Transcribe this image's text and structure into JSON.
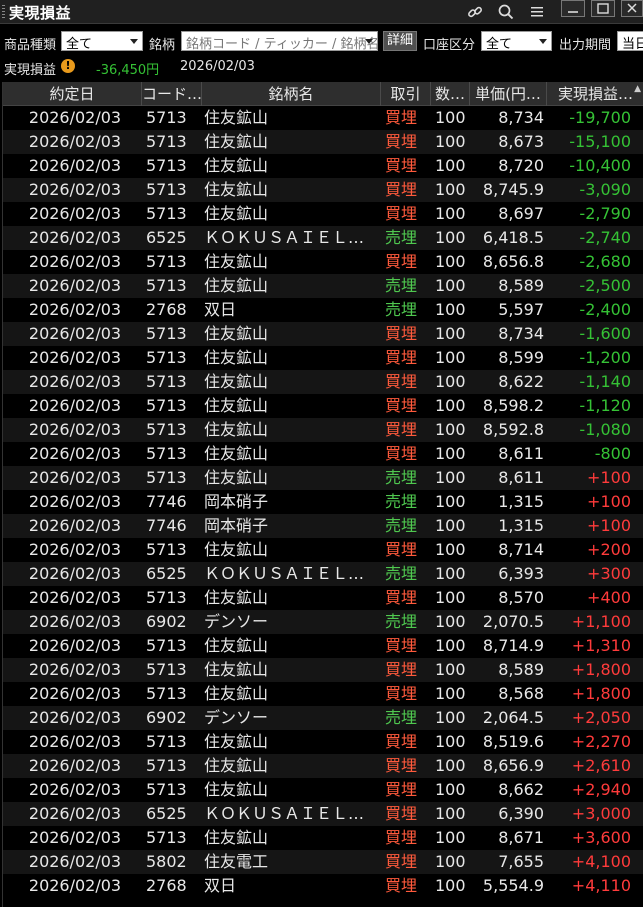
{
  "titlebar": {
    "title": "実現損益",
    "icons": [
      "link-icon",
      "search-icon",
      "menu-icon",
      "minimize-icon",
      "maximize-icon",
      "close-icon"
    ]
  },
  "filters": {
    "product_type_label": "商品種類",
    "product_type_value": "全て",
    "symbol_label": "銘柄",
    "symbol_placeholder": "銘柄コード / ティッカー / 銘柄名",
    "detail_button": "詳細",
    "account_label": "口座区分",
    "account_value": "全て",
    "period_label": "出力期間",
    "period_value": "当日"
  },
  "summary": {
    "label": "実現損益",
    "amount": "-36,450円",
    "date": "2026/02/03"
  },
  "colors": {
    "buy": "#ff5a3c",
    "sell": "#4fc84f",
    "negative": "#35c235",
    "positive": "#ff3b3b",
    "warning": "#e89a1c"
  },
  "table": {
    "columns": [
      "約定日",
      "コード…",
      "銘柄名",
      "取引",
      "数…",
      "単価(円…",
      "実現損益…"
    ],
    "rows": [
      [
        "2026/02/03",
        "5713",
        "住友鉱山",
        "買埋",
        "100",
        "8,734",
        "-19,700"
      ],
      [
        "2026/02/03",
        "5713",
        "住友鉱山",
        "買埋",
        "100",
        "8,673",
        "-15,100"
      ],
      [
        "2026/02/03",
        "5713",
        "住友鉱山",
        "買埋",
        "100",
        "8,720",
        "-10,400"
      ],
      [
        "2026/02/03",
        "5713",
        "住友鉱山",
        "買埋",
        "100",
        "8,745.9",
        "-3,090"
      ],
      [
        "2026/02/03",
        "5713",
        "住友鉱山",
        "買埋",
        "100",
        "8,697",
        "-2,790"
      ],
      [
        "2026/02/03",
        "6525",
        "ＫＯＫＵＳＡＩＥＬ…",
        "売埋",
        "100",
        "6,418.5",
        "-2,740"
      ],
      [
        "2026/02/03",
        "5713",
        "住友鉱山",
        "買埋",
        "100",
        "8,656.8",
        "-2,680"
      ],
      [
        "2026/02/03",
        "5713",
        "住友鉱山",
        "売埋",
        "100",
        "8,589",
        "-2,500"
      ],
      [
        "2026/02/03",
        "2768",
        "双日",
        "売埋",
        "100",
        "5,597",
        "-2,400"
      ],
      [
        "2026/02/03",
        "5713",
        "住友鉱山",
        "買埋",
        "100",
        "8,734",
        "-1,600"
      ],
      [
        "2026/02/03",
        "5713",
        "住友鉱山",
        "買埋",
        "100",
        "8,599",
        "-1,200"
      ],
      [
        "2026/02/03",
        "5713",
        "住友鉱山",
        "買埋",
        "100",
        "8,622",
        "-1,140"
      ],
      [
        "2026/02/03",
        "5713",
        "住友鉱山",
        "買埋",
        "100",
        "8,598.2",
        "-1,120"
      ],
      [
        "2026/02/03",
        "5713",
        "住友鉱山",
        "買埋",
        "100",
        "8,592.8",
        "-1,080"
      ],
      [
        "2026/02/03",
        "5713",
        "住友鉱山",
        "買埋",
        "100",
        "8,611",
        "-800"
      ],
      [
        "2026/02/03",
        "5713",
        "住友鉱山",
        "売埋",
        "100",
        "8,611",
        "+100"
      ],
      [
        "2026/02/03",
        "7746",
        "岡本硝子",
        "売埋",
        "100",
        "1,315",
        "+100"
      ],
      [
        "2026/02/03",
        "7746",
        "岡本硝子",
        "売埋",
        "100",
        "1,315",
        "+100"
      ],
      [
        "2026/02/03",
        "5713",
        "住友鉱山",
        "買埋",
        "100",
        "8,714",
        "+200"
      ],
      [
        "2026/02/03",
        "6525",
        "ＫＯＫＵＳＡＩＥＬ…",
        "売埋",
        "100",
        "6,393",
        "+300"
      ],
      [
        "2026/02/03",
        "5713",
        "住友鉱山",
        "買埋",
        "100",
        "8,570",
        "+400"
      ],
      [
        "2026/02/03",
        "6902",
        "デンソー",
        "売埋",
        "100",
        "2,070.5",
        "+1,100"
      ],
      [
        "2026/02/03",
        "5713",
        "住友鉱山",
        "買埋",
        "100",
        "8,714.9",
        "+1,310"
      ],
      [
        "2026/02/03",
        "5713",
        "住友鉱山",
        "買埋",
        "100",
        "8,589",
        "+1,800"
      ],
      [
        "2026/02/03",
        "5713",
        "住友鉱山",
        "買埋",
        "100",
        "8,568",
        "+1,800"
      ],
      [
        "2026/02/03",
        "6902",
        "デンソー",
        "売埋",
        "100",
        "2,064.5",
        "+2,050"
      ],
      [
        "2026/02/03",
        "5713",
        "住友鉱山",
        "買埋",
        "100",
        "8,519.6",
        "+2,270"
      ],
      [
        "2026/02/03",
        "5713",
        "住友鉱山",
        "買埋",
        "100",
        "8,656.9",
        "+2,610"
      ],
      [
        "2026/02/03",
        "5713",
        "住友鉱山",
        "買埋",
        "100",
        "8,662",
        "+2,940"
      ],
      [
        "2026/02/03",
        "6525",
        "ＫＯＫＵＳＡＩＥＬ…",
        "買埋",
        "100",
        "6,390",
        "+3,000"
      ],
      [
        "2026/02/03",
        "5713",
        "住友鉱山",
        "買埋",
        "100",
        "8,671",
        "+3,600"
      ],
      [
        "2026/02/03",
        "5802",
        "住友電工",
        "買埋",
        "100",
        "7,655",
        "+4,100"
      ],
      [
        "2026/02/03",
        "2768",
        "双日",
        "買埋",
        "100",
        "5,554.9",
        "+4,110"
      ]
    ]
  }
}
